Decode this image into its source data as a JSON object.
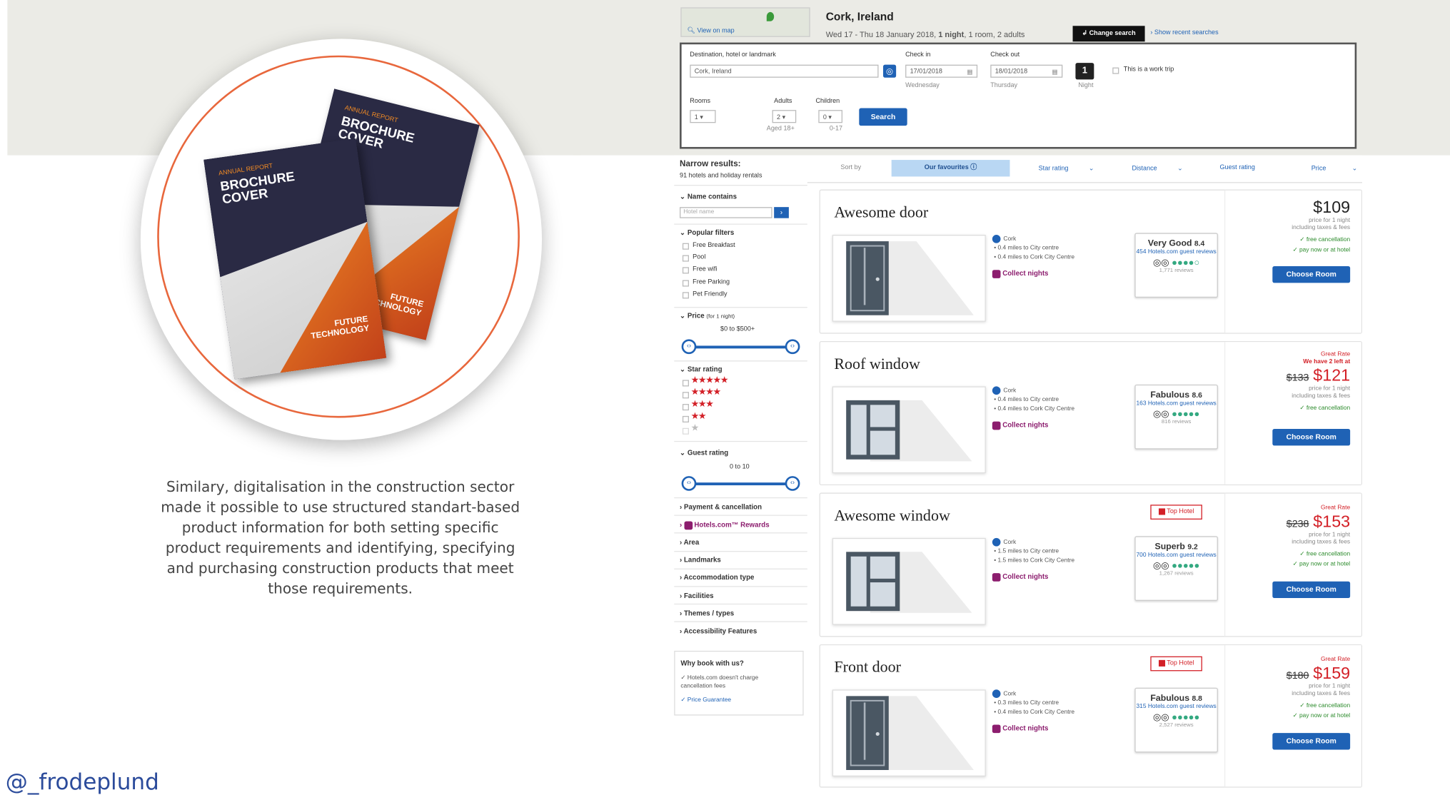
{
  "left_panel": {
    "books": {
      "back": {
        "small": "ANNUAL REPORT",
        "title": "BROCHURE COVER",
        "footer": "FUTURE TECHNOLOGY"
      },
      "front": {
        "small": "ANNUAL REPORT",
        "title": "BROCHURE COVER",
        "footer": "FUTURE TECHNOLOGY"
      }
    },
    "caption": "Similary, digitalisation in the construction sector made it possible to use structured standart-based product information for both setting specific product requirements and identifying, specifying and purchasing construction products that meet those requirements.",
    "handle": "@_frodeplund"
  },
  "header": {
    "view_on_map": "View on map",
    "city": "Cork, Ireland",
    "dates_pre": "Wed 17 - Thu 18 January 2018,",
    "nights": "1 night",
    "dates_post": ", 1 room, 2 adults",
    "change_search": "Change search",
    "show_recent": "Show recent searches"
  },
  "search": {
    "dest_label": "Destination, hotel or landmark",
    "dest_value": "Cork, Ireland",
    "checkin_label": "Check in",
    "checkin_value": "17/01/2018",
    "checkin_day": "Wednesday",
    "checkout_label": "Check out",
    "checkout_value": "18/01/2018",
    "checkout_day": "Thursday",
    "nights_num": "1",
    "nights_label": "Night",
    "work_trip": "This is a work trip",
    "rooms_label": "Rooms",
    "rooms_value": "1",
    "adults_label": "Adults",
    "adults_value": "2",
    "adults_note": "Aged 18+",
    "children_label": "Children",
    "children_value": "0",
    "children_note": "0-17",
    "search_btn": "Search"
  },
  "sidebar": {
    "narrow": "Narrow results:",
    "count": "91 hotels and holiday rentals",
    "name_contains": "Name contains",
    "hotel_name_placeholder": "Hotel name",
    "popular": "Popular filters",
    "filters": [
      "Free Breakfast",
      "Pool",
      "Free wifi",
      "Free Parking",
      "Pet Friendly"
    ],
    "price": "Price",
    "price_note": "(for 1 night)",
    "price_range": "$0 to $500+",
    "star_rating": "Star rating",
    "stars": [
      "★★★★★",
      "★★★★",
      "★★★",
      "★★",
      "★"
    ],
    "guest_rating": "Guest rating",
    "guest_range": "0 to 10",
    "sections": [
      "Payment & cancellation",
      "Hotels.com™ Rewards",
      "Area",
      "Landmarks",
      "Accommodation type",
      "Facilities",
      "Themes / types",
      "Accessibility Features"
    ],
    "why": "Why book with us?",
    "why_items": [
      "Hotels.com doesn't charge cancellation fees",
      "Price Guarantee"
    ]
  },
  "sort": {
    "sort_by": "Sort by",
    "options": [
      "Our favourites ⓘ",
      "Star rating",
      "Distance",
      "Guest rating",
      "Price"
    ]
  },
  "listings": [
    {
      "title": "Awesome door",
      "city": "Cork",
      "d1": "0.4 miles to City centre",
      "d2": "0.4 miles to Cork City Centre",
      "collect": "Collect nights",
      "rating": "Very Good",
      "score": "8.4",
      "reviews_link": "454 Hotels.com guest reviews",
      "ta": "●●●●○",
      "ta_reviews": "1,771 reviews",
      "great": "",
      "left": "",
      "old": "",
      "price": "$109",
      "note1": "price for 1 night",
      "note2": "including taxes & fees",
      "free_cancel": "free cancellation",
      "pay": "pay now or at hotel",
      "choose": "Choose Room",
      "top": ""
    },
    {
      "title": "Roof window",
      "city": "Cork",
      "d1": "0.4 miles to City centre",
      "d2": "0.4 miles to Cork City Centre",
      "collect": "Collect nights",
      "rating": "Fabulous",
      "score": "8.6",
      "reviews_link": "163 Hotels.com guest reviews",
      "ta": "●●●●●",
      "ta_reviews": "816 reviews",
      "great": "Great Rate",
      "left": "We have 2 left at",
      "old": "$133",
      "price": "$121",
      "note1": "price for 1 night",
      "note2": "including taxes & fees",
      "free_cancel": "free cancellation",
      "pay": "",
      "choose": "Choose Room",
      "top": ""
    },
    {
      "title": "Awesome window",
      "city": "Cork",
      "d1": "1.5 miles to City centre",
      "d2": "1.5 miles to Cork City Centre",
      "collect": "Collect nights",
      "rating": "Superb",
      "score": "9.2",
      "reviews_link": "700 Hotels.com guest reviews",
      "ta": "●●●●●",
      "ta_reviews": "1,267 reviews",
      "great": "Great Rate",
      "left": "",
      "old": "$238",
      "price": "$153",
      "note1": "price for 1 night",
      "note2": "including taxes & fees",
      "free_cancel": "free cancellation",
      "pay": "pay now or at hotel",
      "choose": "Choose Room",
      "top": "Top Hotel"
    },
    {
      "title": "Front door",
      "city": "Cork",
      "d1": "0.3 miles to City centre",
      "d2": "0.4 miles to Cork City Centre",
      "collect": "Collect nights",
      "rating": "Fabulous",
      "score": "8.8",
      "reviews_link": "315 Hotels.com guest reviews",
      "ta": "●●●●●",
      "ta_reviews": "2,527 reviews",
      "great": "Great Rate",
      "left": "",
      "old": "$180",
      "price": "$159",
      "note1": "price for 1 night",
      "note2": "including taxes & fees",
      "free_cancel": "free cancellation",
      "pay": "pay now or at hotel",
      "choose": "Choose Room",
      "top": "Top Hotel"
    }
  ],
  "colors": {
    "brand_blue": "#1f62b5",
    "accent_red": "#d32027",
    "orange": "#e8673c",
    "dark_navy": "#2a2a44"
  }
}
